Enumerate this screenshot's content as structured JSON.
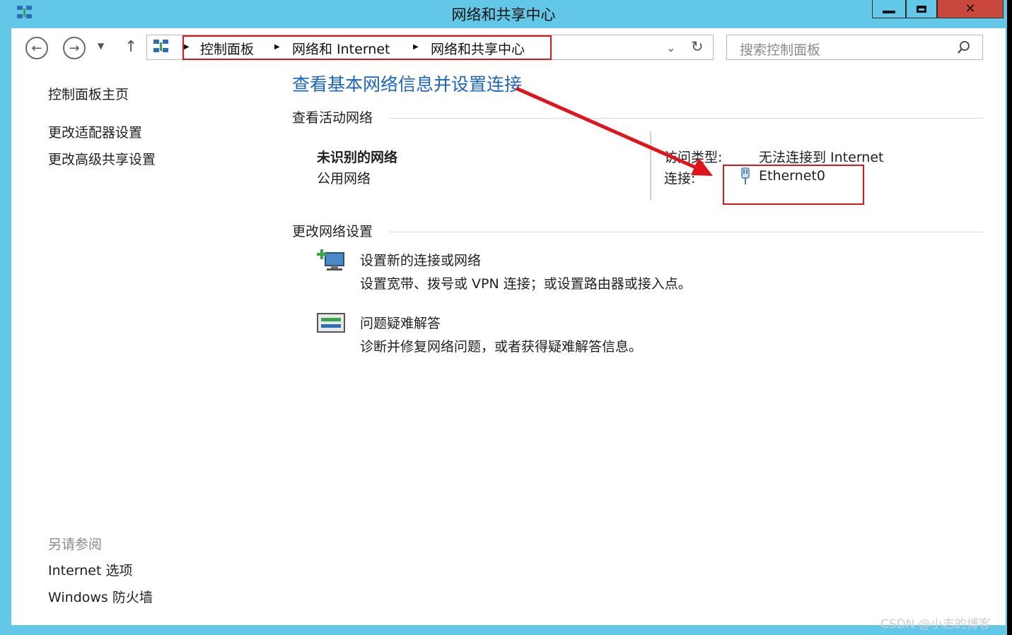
{
  "window": {
    "title": "网络和共享中心",
    "controls": [
      "minimize-icon",
      "maximize-icon",
      "close-icon"
    ]
  },
  "nav": {
    "breadcrumb": [
      "控制面板",
      "网络和 Internet",
      "网络和共享中心"
    ],
    "search_placeholder": "搜索控制面板"
  },
  "sidebar": {
    "items": [
      "控制面板主页",
      "更改适配器设置",
      "更改高级共享设置"
    ],
    "see_also_title": "另请参阅",
    "see_also": [
      "Internet 选项",
      "Windows 防火墙"
    ]
  },
  "main": {
    "heading": "查看基本网络信息并设置连接",
    "active_networks_title": "查看活动网络",
    "network": {
      "name": "未识别的网络",
      "type": "公用网络",
      "access_type_label": "访问类型:",
      "access_type_value": "无法连接到 Internet",
      "connections_label": "连接:",
      "connection_name": "Ethernet0"
    },
    "change_settings_title": "更改网络设置",
    "tasks": [
      {
        "title": "设置新的连接或网络",
        "desc": "设置宽带、拨号或 VPN 连接；或设置路由器或接入点。"
      },
      {
        "title": "问题疑难解答",
        "desc": "诊断并修复网络问题，或者获得疑难解答信息。"
      }
    ]
  },
  "watermark": "CSDN @小志的博客",
  "colors": {
    "titlebar": "#63c7e8",
    "link": "#1a64c8",
    "annotation": "#e1141b"
  }
}
